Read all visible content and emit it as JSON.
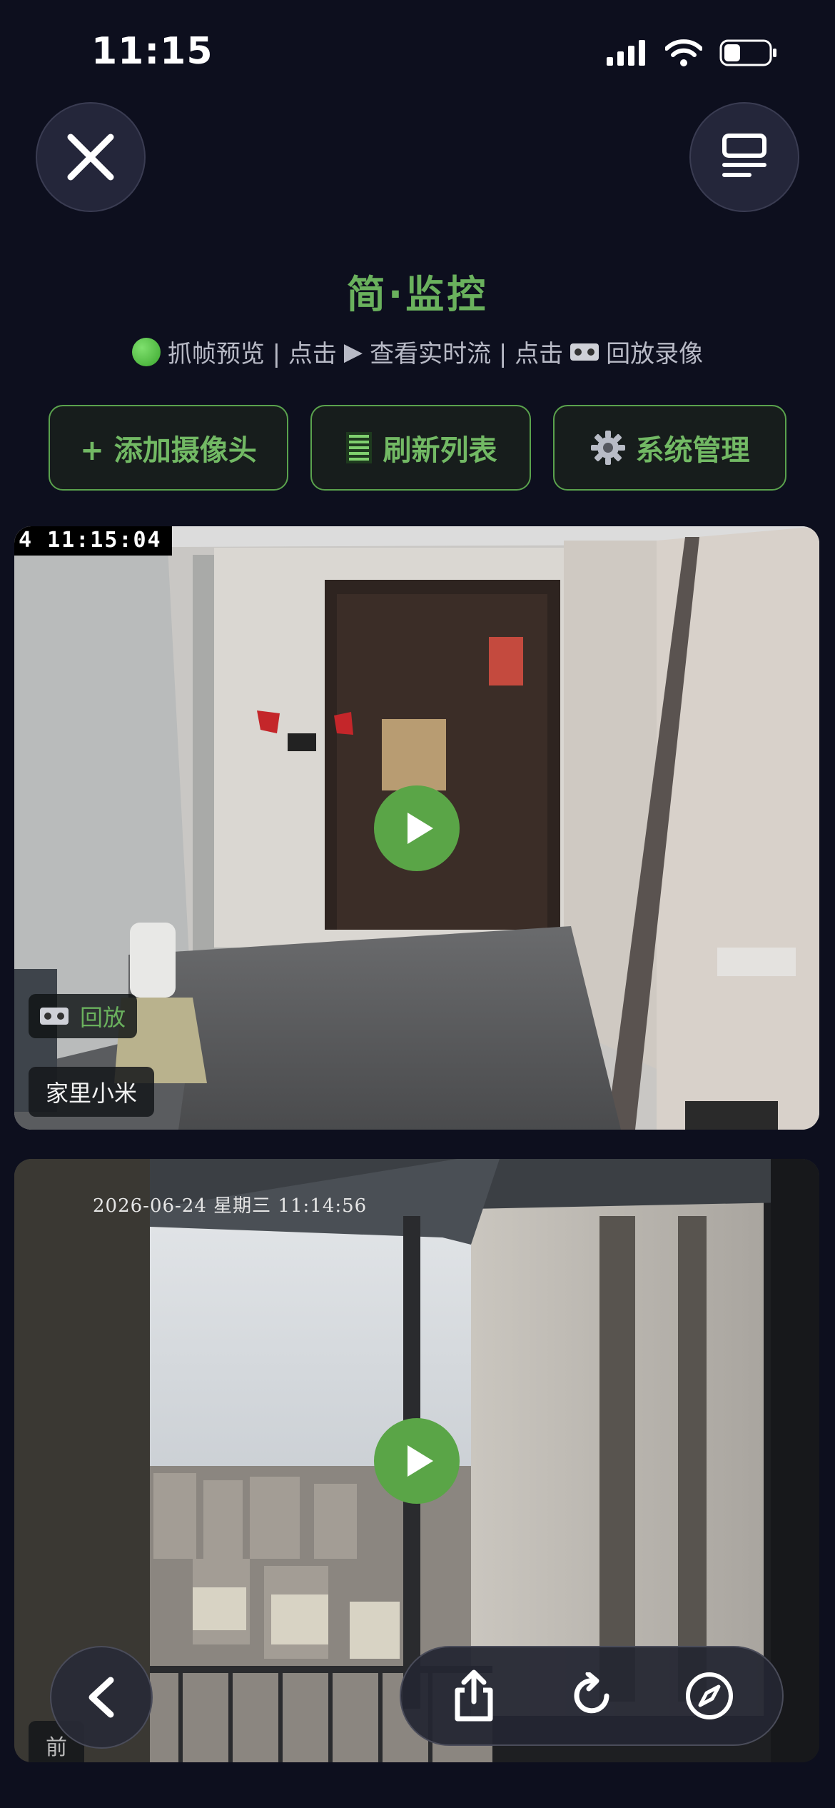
{
  "status_bar": {
    "time": "11:15"
  },
  "header": {
    "title": "简·监控",
    "subtitle_parts": [
      "抓帧预览 | 点击",
      "查看实时流 | 点击",
      "回放录像"
    ]
  },
  "actions": {
    "add_camera": "+ 添加摄像头",
    "refresh_list": "刷新列表",
    "system_manage": "系统管理"
  },
  "cameras": [
    {
      "timestamp": "4 11:15:04",
      "replay_label": "回放",
      "name": "家里小米"
    },
    {
      "timestamp": "2026-06-24 星期三 11:14:56",
      "name_partial": "前"
    }
  ],
  "icons": {
    "close": "close-icon",
    "menu": "list-icon",
    "back": "chevron-left-icon",
    "share": "share-icon",
    "reload": "reload-icon",
    "compass": "compass-icon"
  },
  "colors": {
    "accent": "#6ab15d",
    "background": "#0d0f1e"
  }
}
